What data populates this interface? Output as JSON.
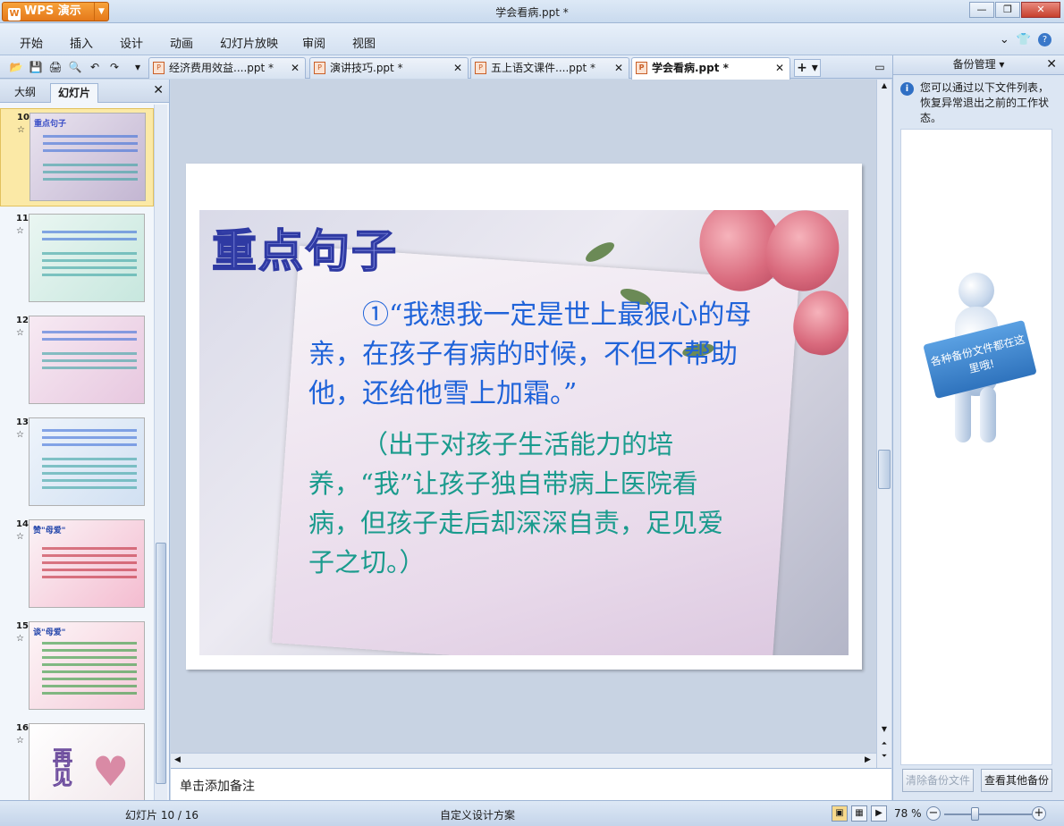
{
  "app": {
    "name": "WPS 演示",
    "window_title": "学会看病.ppt *"
  },
  "menu": [
    "开始",
    "插入",
    "设计",
    "动画",
    "幻灯片放映",
    "审阅",
    "视图"
  ],
  "tabs": [
    {
      "label": "经济费用效益....ppt *",
      "active": false
    },
    {
      "label": "演讲技巧.ppt *",
      "active": false
    },
    {
      "label": "五上语文课件....ppt *",
      "active": false
    },
    {
      "label": "学会看病.ppt *",
      "active": true
    }
  ],
  "left_panel": {
    "tabs": [
      "大纲",
      "幻灯片"
    ],
    "slides": [
      {
        "num": "10",
        "title": "重点句子",
        "selected": true
      },
      {
        "num": "11",
        "title": "",
        "selected": false
      },
      {
        "num": "12",
        "title": "",
        "selected": false
      },
      {
        "num": "13",
        "title": "",
        "selected": false
      },
      {
        "num": "14",
        "title": "赞\"母爱\"",
        "selected": false
      },
      {
        "num": "15",
        "title": "谈\"母爱\"",
        "selected": false
      },
      {
        "num": "16",
        "title": "再见",
        "selected": false
      }
    ]
  },
  "slide": {
    "title": "重点句子",
    "text1": "①“我想我一定是世上最狠心的母亲，在孩子有病的时候，不但不帮助他，还给他雪上加霜。”",
    "text2": "（出于对孩子生活能力的培养，“我”让孩子独自带病上医院看病，但孩子走后却深深自责，足见爱子之切。）"
  },
  "notes_placeholder": "单击添加备注",
  "backup_panel": {
    "title": "备份管理",
    "info": "您可以通过以下文件列表，恢复异常退出之前的工作状态。",
    "sign_text": "各种备份文件都在这里哦!",
    "clear_button": "清除备份文件",
    "view_button": "查看其他备份"
  },
  "status": {
    "slide_counter": "幻灯片 10 / 16",
    "design": "自定义设计方案",
    "zoom": "78 %"
  }
}
